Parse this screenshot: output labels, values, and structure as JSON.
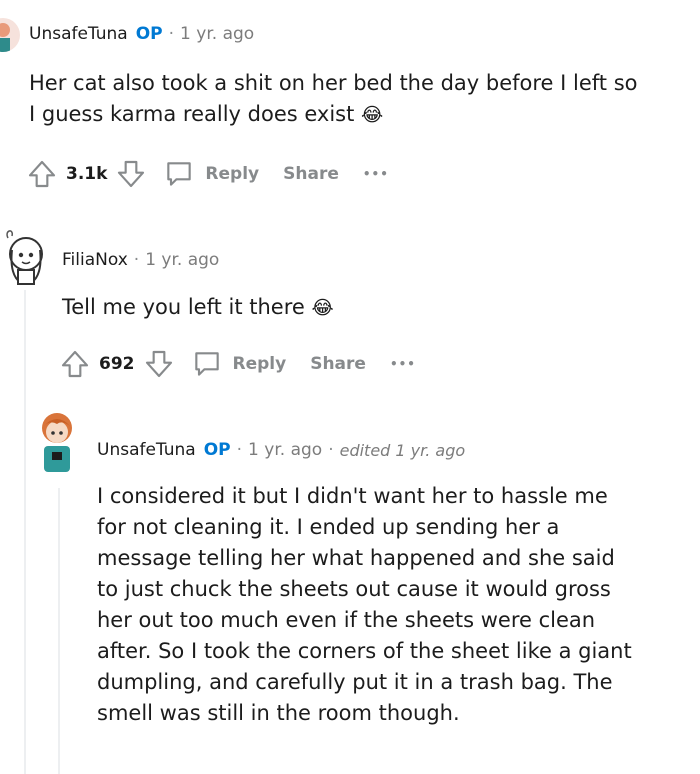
{
  "comments": [
    {
      "username": "UnsafeTuna",
      "op_badge": "OP",
      "separator": "·",
      "time": "1 yr. ago",
      "text_line1": "Her cat also took a shit on her bed the day before I left so",
      "text_line2": "I guess karma really does exist",
      "emoji": "😂",
      "votes": "3.1k",
      "reply_label": "Reply",
      "share_label": "Share",
      "more_label": "•••"
    },
    {
      "username": "FiliaNox",
      "separator": "·",
      "time": "1 yr. ago",
      "text": "Tell me you left it there",
      "emoji": "😂",
      "votes": "692",
      "reply_label": "Reply",
      "share_label": "Share",
      "more_label": "•••"
    },
    {
      "username": "UnsafeTuna",
      "op_badge": "OP",
      "separator": "·",
      "time": "1 yr. ago",
      "separator2": "·",
      "edited": "edited 1 yr. ago",
      "lines": [
        "I considered it but I didn't want her to hassle me",
        "for not cleaning it. I ended up sending her a",
        "message telling her what happened and she said",
        "to just chuck the sheets out cause it would gross",
        "her out too much even if the sheets were clean",
        "after. So I took the corners of the sheet like a giant",
        "dumpling, and carefully put it in a trash bag. The",
        "smell was still in the room though."
      ]
    }
  ],
  "colors": {
    "op": "#0079d3",
    "meta": "#7c7c7c",
    "thread_line": "#edeff1"
  },
  "icons": [
    "upvote-icon",
    "downvote-icon",
    "reply-bubble-icon",
    "more-dots-icon"
  ]
}
